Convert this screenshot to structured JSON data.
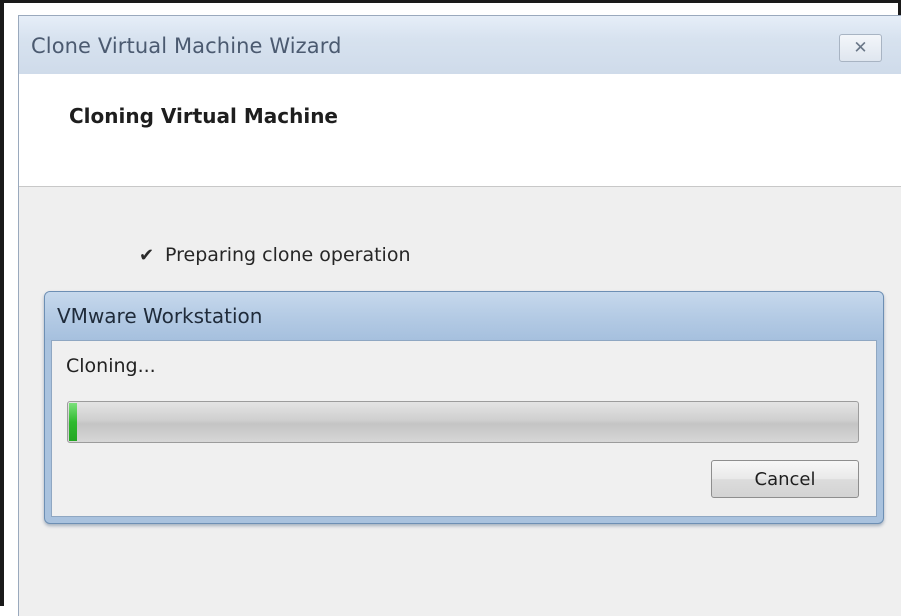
{
  "window": {
    "title": "Clone Virtual Machine Wizard",
    "close_glyph": "✕"
  },
  "header": {
    "title": "Cloning Virtual Machine"
  },
  "steps": [
    {
      "check": "✔",
      "label": "Preparing clone operation"
    }
  ],
  "progress_dialog": {
    "title": "VMware Workstation",
    "status": "Cloning...",
    "progress_fraction": 0.01,
    "cancel_label": "Cancel"
  },
  "colors": {
    "progress_green": "#2fba2f",
    "dialog_frame": "#a9c2de"
  }
}
